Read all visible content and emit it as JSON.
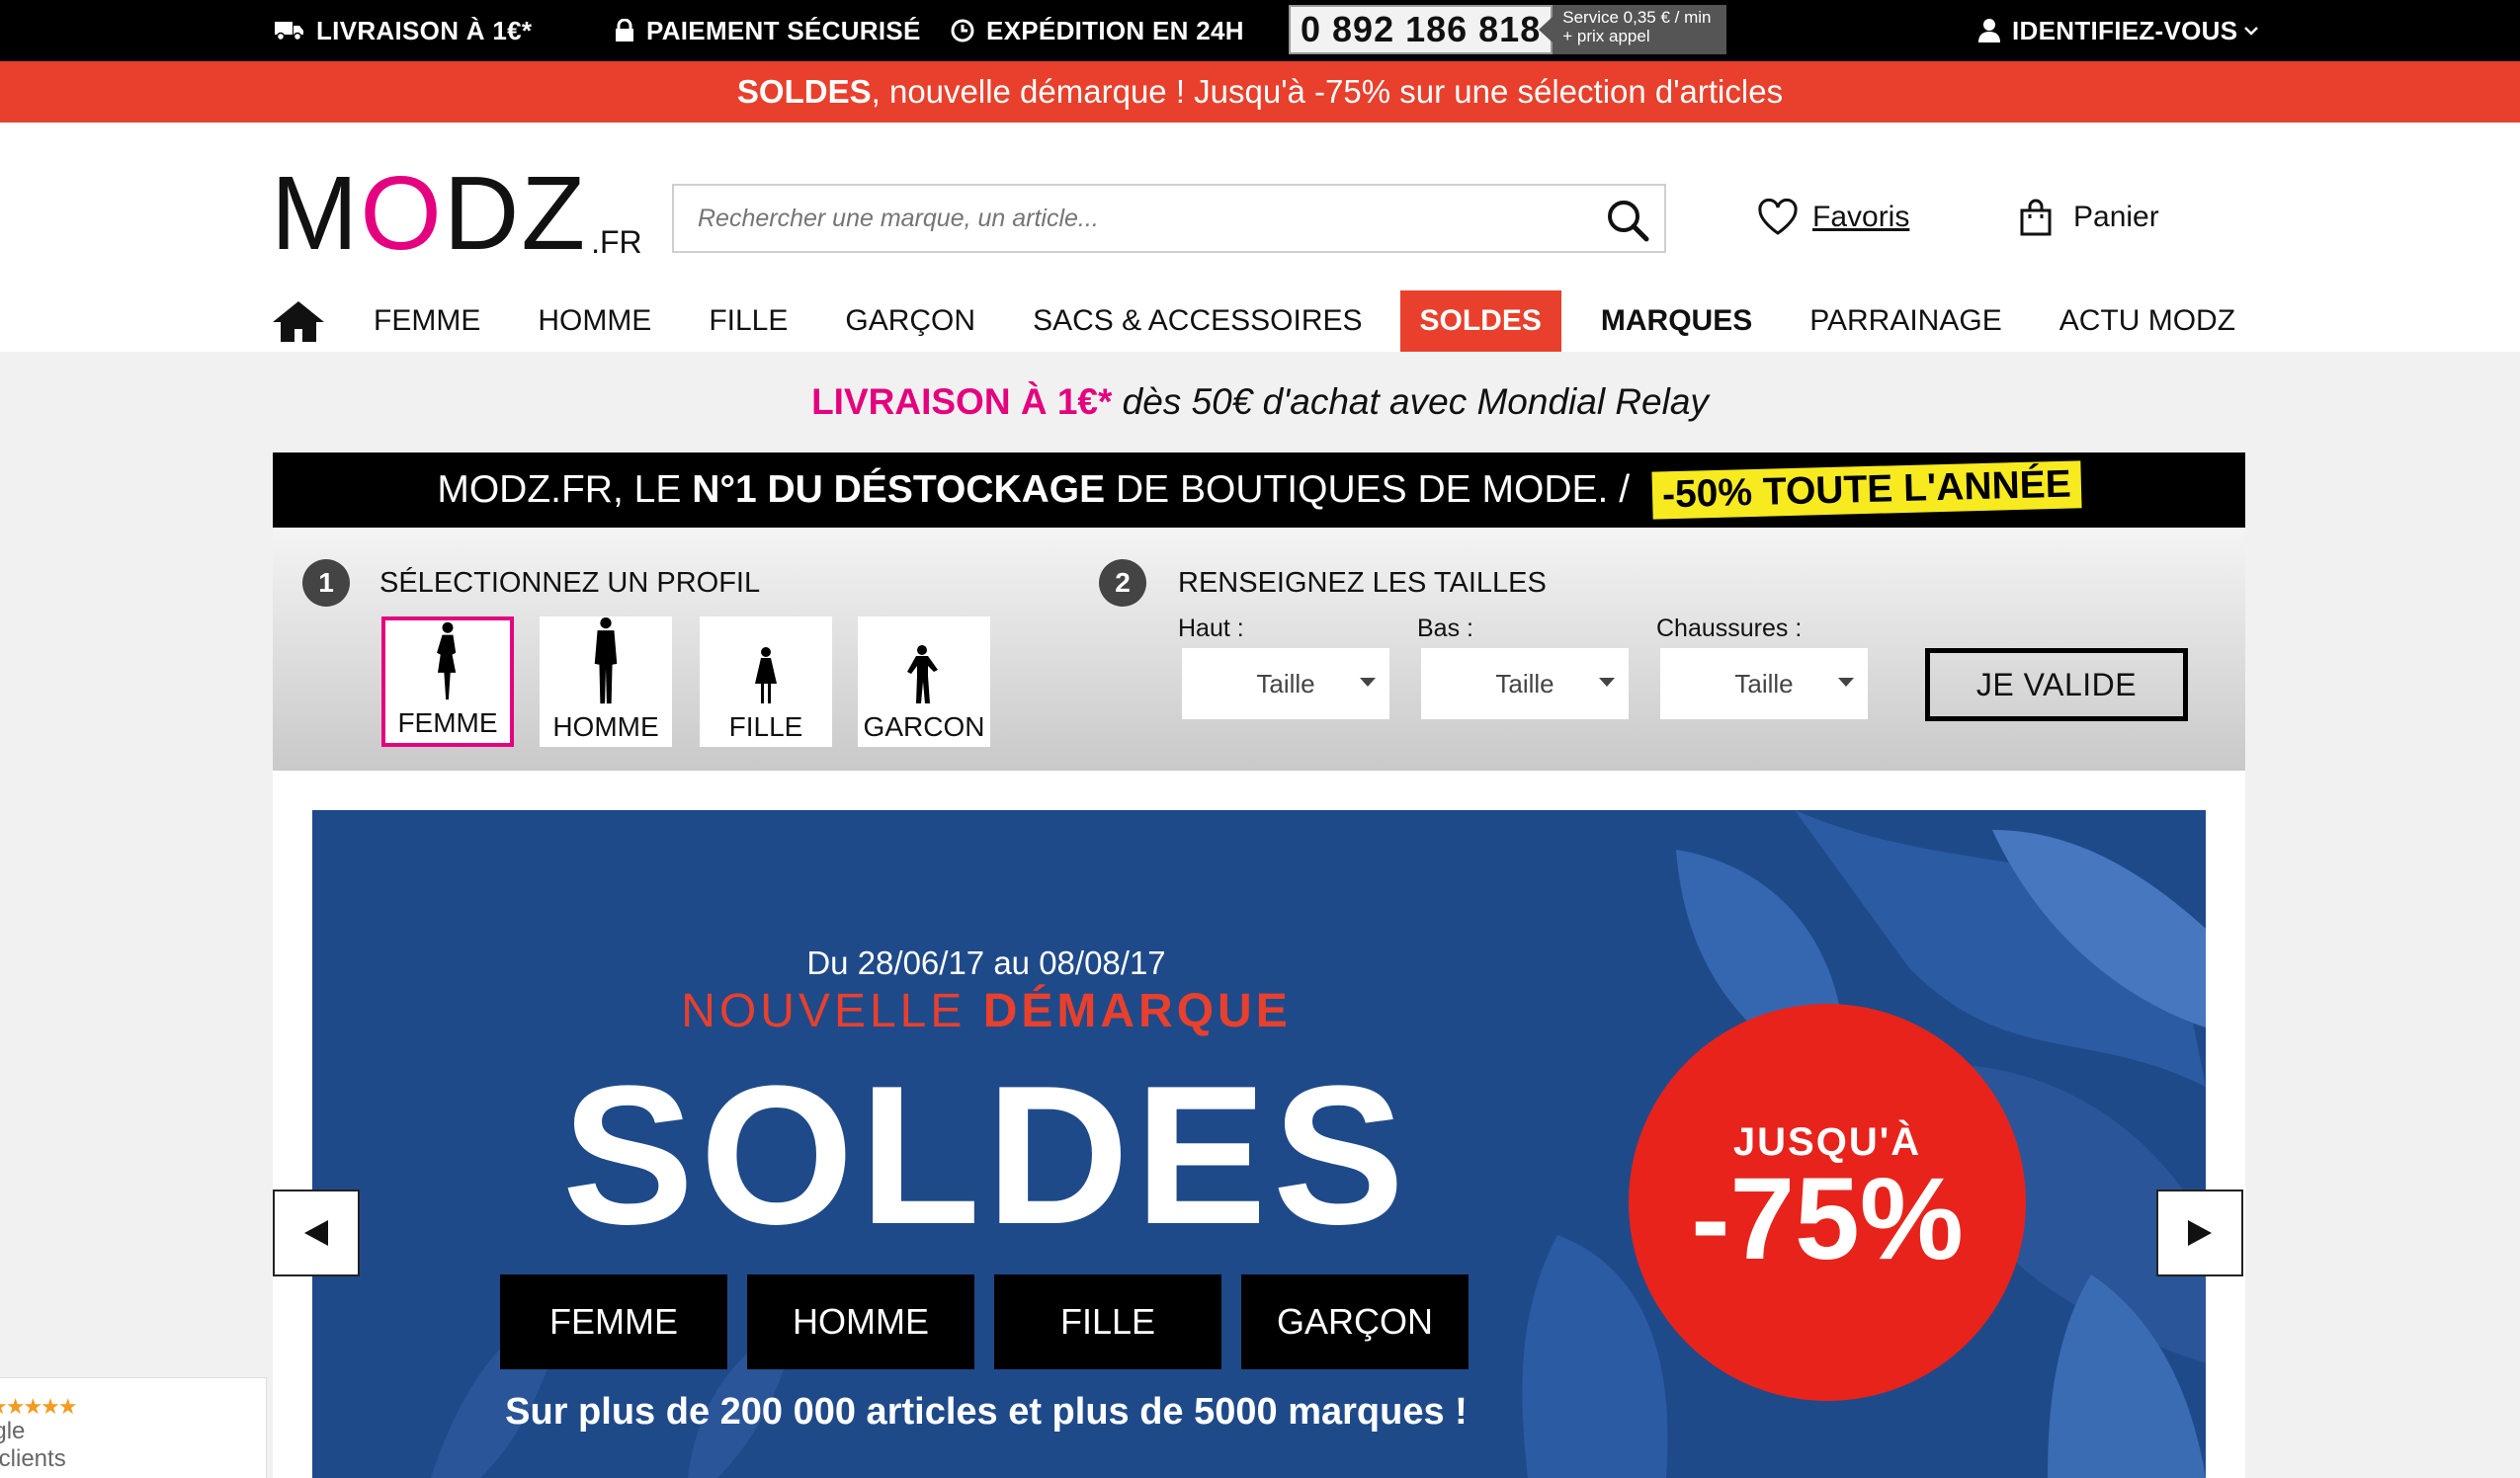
{
  "topbar": {
    "delivery": "LIVRAISON À 1€*",
    "payment": "PAIEMENT SÉCURISÉ",
    "shipping": "EXPÉDITION EN 24H",
    "phone": "0 892 186 818",
    "phone_service_line1": "Service 0,35 € / min",
    "phone_service_line2": "+ prix appel",
    "login": "IDENTIFIEZ-VOUS"
  },
  "promo": {
    "bold": "SOLDES",
    "text": ", nouvelle démarque ! Jusqu'à -75% sur une sélection d'articles"
  },
  "logo": {
    "m": "M",
    "o": "O",
    "dz": "DZ",
    "suffix": ".FR"
  },
  "search": {
    "placeholder": "Rechercher une marque, un article..."
  },
  "header": {
    "favorites": "Favoris",
    "cart": "Panier"
  },
  "nav": {
    "items": [
      "FEMME",
      "HOMME",
      "FILLE",
      "GARÇON",
      "SACS & ACCESSOIRES",
      "SOLDES",
      "MARQUES",
      "PARRAINAGE",
      "ACTU MODZ"
    ]
  },
  "shipping_line": {
    "highlight": "LIVRAISON À 1€*",
    "text": " dès 50€ d'achat avec Mondial Relay"
  },
  "banner": {
    "part1": "MODZ.FR, LE ",
    "bold": "N°1 DU DÉSTOCKAGE",
    "part2": " DE BOUTIQUES DE MODE. / ",
    "highlight": "-50% TOUTE L'ANNÉE"
  },
  "selector": {
    "step1_num": "1",
    "step1_label": "SÉLECTIONNEZ UN PROFIL",
    "step2_num": "2",
    "step2_label": "RENSEIGNEZ LES TAILLES",
    "profiles": [
      "FEMME",
      "HOMME",
      "FILLE",
      "GARCON"
    ],
    "selected_profile": "FEMME",
    "size_labels": [
      "Haut :",
      "Bas :",
      "Chaussures :"
    ],
    "size_placeholder": "Taille",
    "validate": "JE VALIDE"
  },
  "hero": {
    "dates": "Du 28/06/17 au 08/08/17",
    "nouvelle": "NOUVELLE ",
    "demarque": "DÉMARQUE",
    "title": "SOLDES",
    "categories": [
      "FEMME",
      "HOMME",
      "FILLE",
      "GARÇON"
    ],
    "subtitle": "Sur plus de 200 000 articles et plus de 5000 marques !",
    "circle_top": "JUSQU'À",
    "circle_value": "-75%"
  },
  "review_widget": {
    "stars": "★★★★★",
    "line1": "ogle",
    "line2": "s clients"
  },
  "colors": {
    "brand_pink": "#e4007e",
    "promo_red": "#e8402c",
    "hero_blue": "#1f4a8a",
    "highlight_yellow": "#f7ea1f"
  }
}
